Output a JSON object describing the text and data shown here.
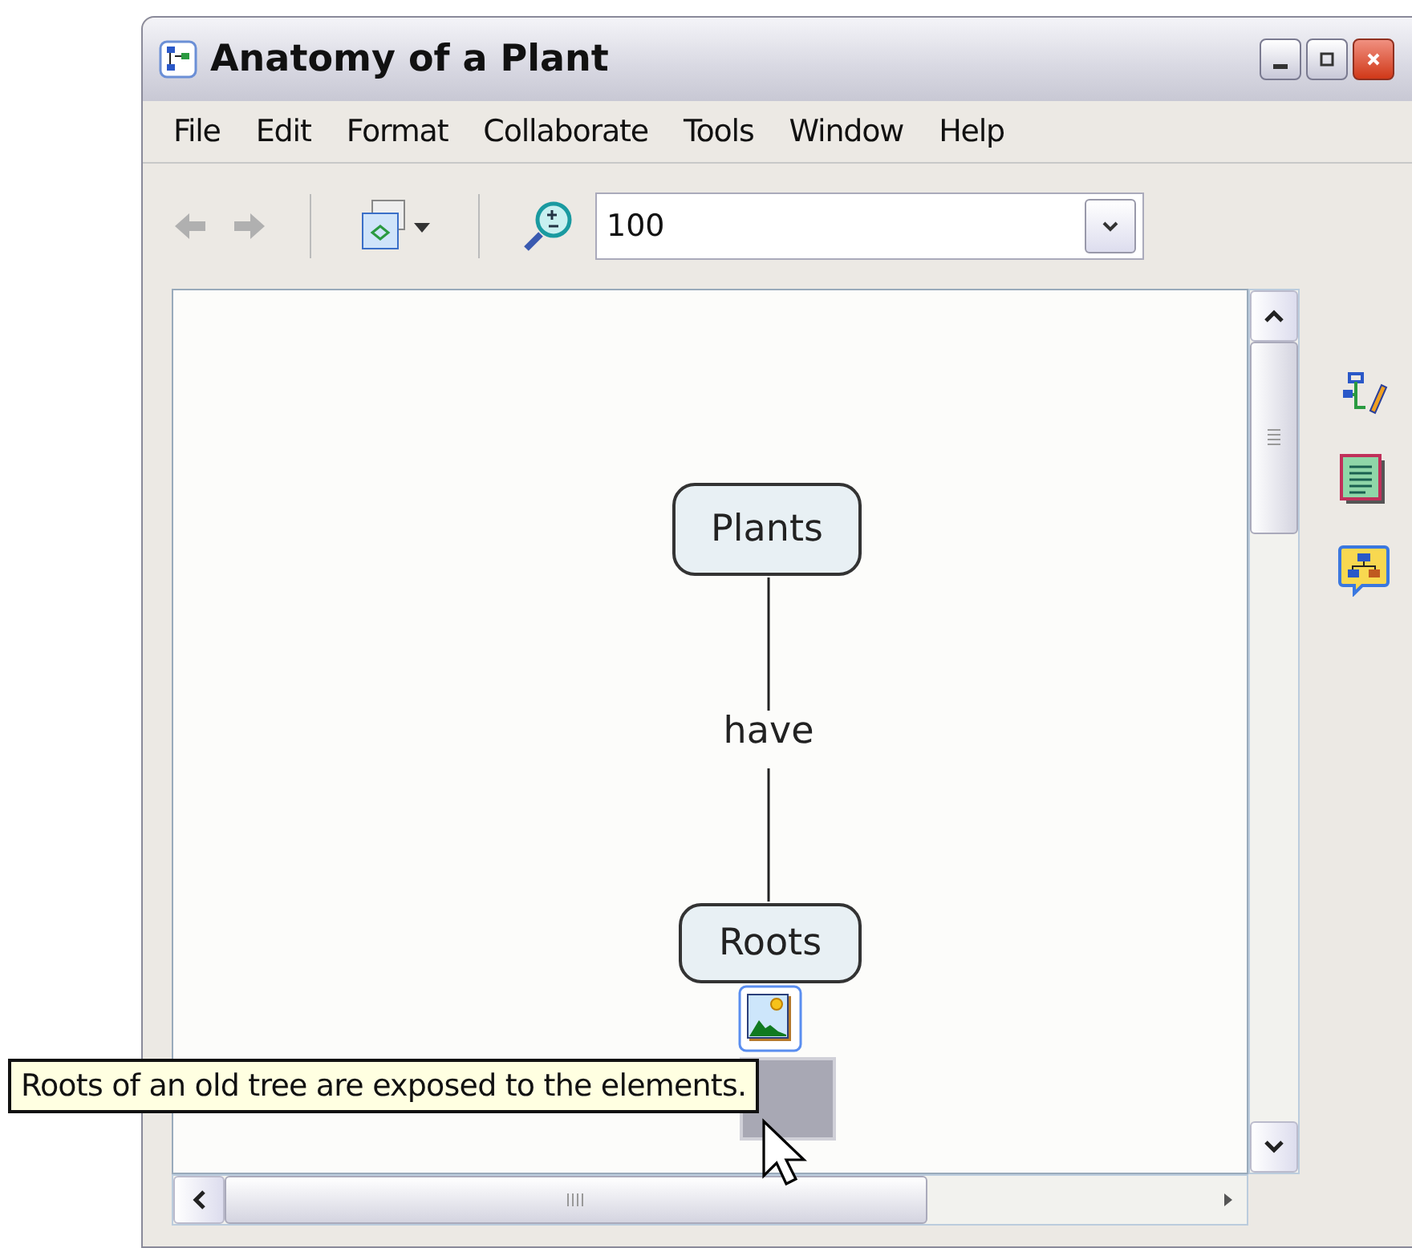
{
  "window": {
    "title": "Anatomy of a Plant"
  },
  "menu": [
    "File",
    "Edit",
    "Format",
    "Collaborate",
    "Tools",
    "Window",
    "Help"
  ],
  "toolbar": {
    "zoom": "100"
  },
  "map": {
    "concepts": [
      {
        "label": "Plants",
        "has_resource": false
      },
      {
        "label": "Roots",
        "has_resource": true
      }
    ],
    "link": {
      "label": "have"
    }
  },
  "tooltip": {
    "text": "Roots of an old tree are exposed to the elements."
  }
}
